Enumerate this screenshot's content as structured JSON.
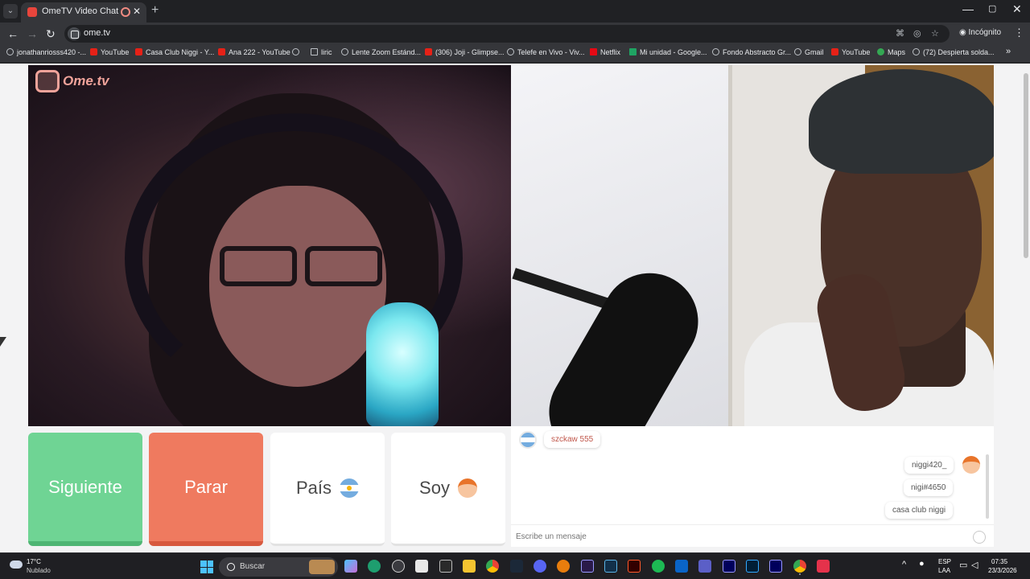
{
  "browser": {
    "tab_title": "OmeTV Video Chat — Ome",
    "url": "ome.tv",
    "incognito_label": "Incógnito"
  },
  "bookmarks": [
    {
      "label": "jonathanriosss420 -...",
      "icon": "youtube-icon"
    },
    {
      "label": "YouTube",
      "icon": "youtube-icon"
    },
    {
      "label": "Casa Club Niggi - Y...",
      "icon": "youtube-icon"
    },
    {
      "label": "Ana 222 - YouTube",
      "icon": "youtube-icon"
    },
    {
      "label": "",
      "icon": "globe-icon"
    },
    {
      "label": "liric",
      "icon": "folder-icon"
    },
    {
      "label": "Lente Zoom Estánd...",
      "icon": "globe-icon"
    },
    {
      "label": "(306) Joji - Glimpse...",
      "icon": "youtube-icon"
    },
    {
      "label": "Telefe en Vivo - Viv...",
      "icon": "globe-icon"
    },
    {
      "label": "Netflix",
      "icon": "netflix-icon"
    },
    {
      "label": "Mi unidad - Google...",
      "icon": "drive-icon"
    },
    {
      "label": "Fondo Abstracto Gr...",
      "icon": "globe-icon"
    },
    {
      "label": "Gmail",
      "icon": "globe-icon"
    },
    {
      "label": "YouTube",
      "icon": "youtube-icon"
    },
    {
      "label": "Maps",
      "icon": "maps-icon"
    },
    {
      "label": "(72) Despierta solda...",
      "icon": "globe-icon"
    }
  ],
  "controls": {
    "next": "Siguiente",
    "stop": "Parar",
    "country": "País",
    "gender": "Soy"
  },
  "video": {
    "logo_text": "Ome.tv"
  },
  "chat": {
    "incoming": [
      {
        "text": "szckaw 555"
      }
    ],
    "outgoing": [
      {
        "text": "niggi420_"
      },
      {
        "text": "nigi#4650"
      },
      {
        "text": "casa club niggi"
      }
    ],
    "input_placeholder": "Escribe un mensaje"
  },
  "taskbar": {
    "weather_temp": "17°C",
    "weather_condition": "Nublado",
    "search_placeholder": "Buscar",
    "lang_1": "ESP",
    "lang_2": "LAA",
    "time": "07:35",
    "date": "23/3/2026"
  },
  "colors": {
    "next_button": "#6fd494",
    "stop_button": "#ef7a5f",
    "brand": "#f0a39a"
  }
}
